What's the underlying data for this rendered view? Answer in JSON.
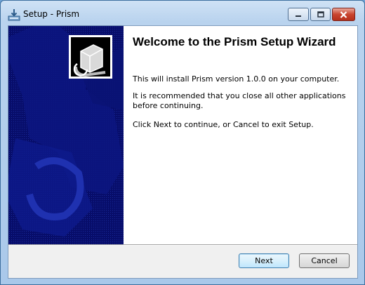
{
  "window": {
    "title": "Setup - Prism",
    "icons": {
      "app": "setup-installer-icon",
      "minimize": "minimize-icon",
      "maximize": "maximize-icon",
      "close": "close-icon"
    },
    "close_color": "#c9442e"
  },
  "sidebar": {
    "background": "#070d6a",
    "logo": "installer-box-logo"
  },
  "content": {
    "heading": "Welcome to the Prism Setup Wizard",
    "paragraph1": "This will install Prism version 1.0.0 on your computer.",
    "paragraph2": "It is recommended that you close all other applications before continuing.",
    "paragraph3": "Click Next to continue, or Cancel to exit Setup."
  },
  "buttons": {
    "next": "Next",
    "cancel": "Cancel"
  }
}
